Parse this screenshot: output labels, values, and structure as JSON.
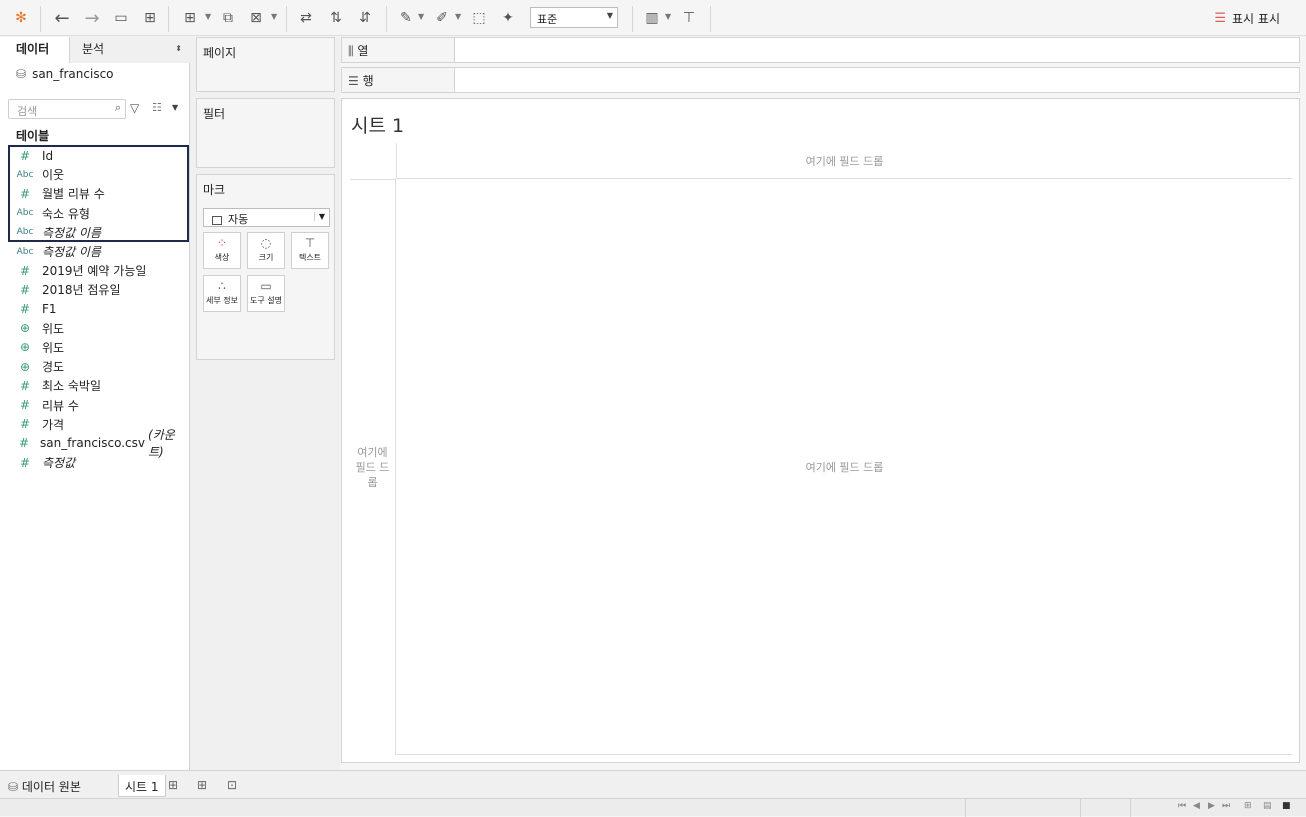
{
  "toolbar": {
    "icons": [
      "tableau-logo-icon",
      "undo-icon",
      "redo-icon",
      "save-icon",
      "new-datasource-icon",
      "new-worksheet-icon",
      "duplicate-icon",
      "clear-icon",
      "swap-icon",
      "sort-asc-icon",
      "sort-desc-icon",
      "highlight-icon",
      "annotate-icon",
      "fit-icon",
      "pin-icon",
      "chart-icon",
      "presentation-icon"
    ],
    "fit_select": "표준",
    "show_me": "표시 표시"
  },
  "left_pane": {
    "tab_data": "데이터",
    "tab_analysis": "분석",
    "datasource": "san_francisco",
    "search_placeholder": "검색",
    "section_title": "테이블",
    "fields": [
      {
        "type": "num",
        "name": "Id",
        "italic": false
      },
      {
        "type": "abc",
        "name": "이웃",
        "italic": false
      },
      {
        "type": "num",
        "name": "월별 리뷰 수",
        "italic": false
      },
      {
        "type": "abc",
        "name": "숙소 유형",
        "italic": false
      },
      {
        "type": "abc",
        "name": "측정값 이름",
        "italic": true
      },
      {
        "type": "abc",
        "name": "측정값 이름",
        "italic": true
      },
      {
        "type": "num",
        "name": "2019년 예약 가능일",
        "italic": false
      },
      {
        "type": "num",
        "name": "2018년 점유일",
        "italic": false
      },
      {
        "type": "num",
        "name": "F1",
        "italic": false
      },
      {
        "type": "geo",
        "name": "위도",
        "italic": false
      },
      {
        "type": "geo",
        "name": "위도",
        "italic": false
      },
      {
        "type": "geo",
        "name": "경도",
        "italic": false
      },
      {
        "type": "num",
        "name": "최소 숙박일",
        "italic": false
      },
      {
        "type": "num",
        "name": "리뷰 수",
        "italic": false
      },
      {
        "type": "num",
        "name": "가격",
        "italic": false
      },
      {
        "type": "num",
        "name": "san_francisco.csv",
        "suffix": "(카운트)",
        "italic": false
      },
      {
        "type": "num",
        "name": "측정값",
        "italic": true
      }
    ],
    "type_glyphs": {
      "num": "#",
      "abc": "Abc",
      "geo": "⊕"
    }
  },
  "cards": {
    "pages": "페이지",
    "filters": "필터",
    "marks": "마크",
    "marks_type": "자동",
    "mark_buttons": [
      "색상",
      "크기",
      "텍스트",
      "세부 정보",
      "도구 설명"
    ]
  },
  "shelves": {
    "columns": "열",
    "rows": "행"
  },
  "canvas": {
    "sheet_title": "시트 1",
    "col_drop": "여기에 필드 드롭",
    "row_drop": "여기에 필드 드롭",
    "body_drop": "여기에 필드 드롭"
  },
  "bottom_tabs": {
    "datasource": "데이터 원본",
    "sheet": "시트 1"
  }
}
